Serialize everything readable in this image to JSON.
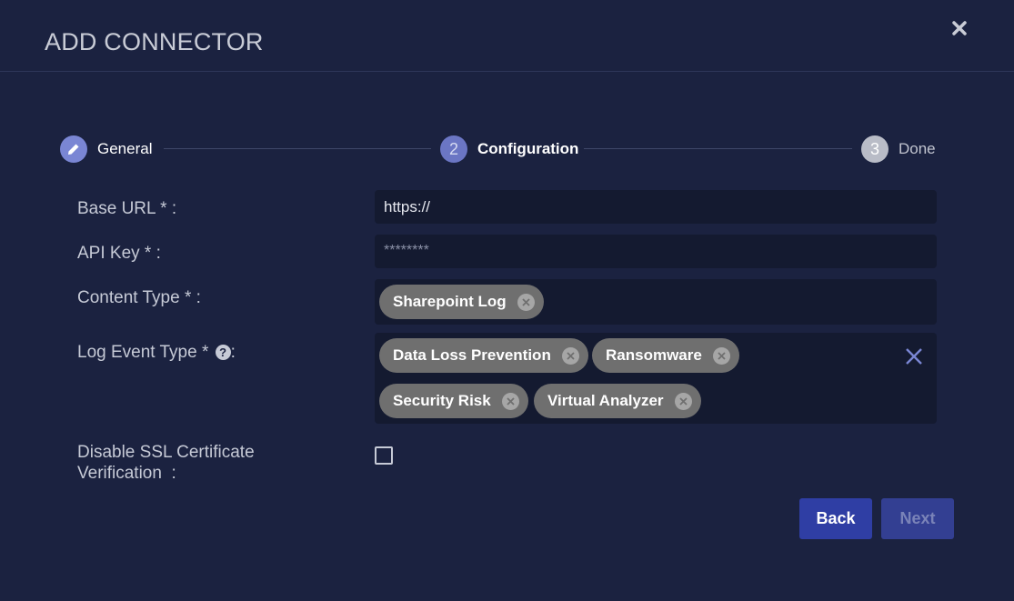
{
  "dialog": {
    "title": "ADD CONNECTOR"
  },
  "stepper": {
    "steps": [
      {
        "icon": "pencil-icon",
        "label": "General"
      },
      {
        "number": "2",
        "label": "Configuration"
      },
      {
        "number": "3",
        "label": "Done"
      }
    ]
  },
  "form": {
    "base_url": {
      "label": "Base URL * :",
      "value": "https://"
    },
    "api_key": {
      "label": "API Key * :",
      "value": "********"
    },
    "content_type": {
      "label": "Content Type * :",
      "chips": [
        "Sharepoint Log"
      ]
    },
    "log_event_type": {
      "label": "Log Event Type * ",
      "help": "?",
      "suffix": ":",
      "chips": [
        "Data Loss Prevention",
        "Ransomware",
        "Security Risk",
        "Virtual Analyzer"
      ]
    },
    "disable_ssl": {
      "label_line1": "Disable SSL Certificate",
      "label_line2": "Verification  :",
      "checked": false
    }
  },
  "actions": {
    "back_label": "Back",
    "next_label": "Next"
  },
  "colors": {
    "background": "#1b2240",
    "accent": "#7a86d4",
    "button_primary": "#2f3ea4",
    "chip": "#6f6f6f"
  }
}
